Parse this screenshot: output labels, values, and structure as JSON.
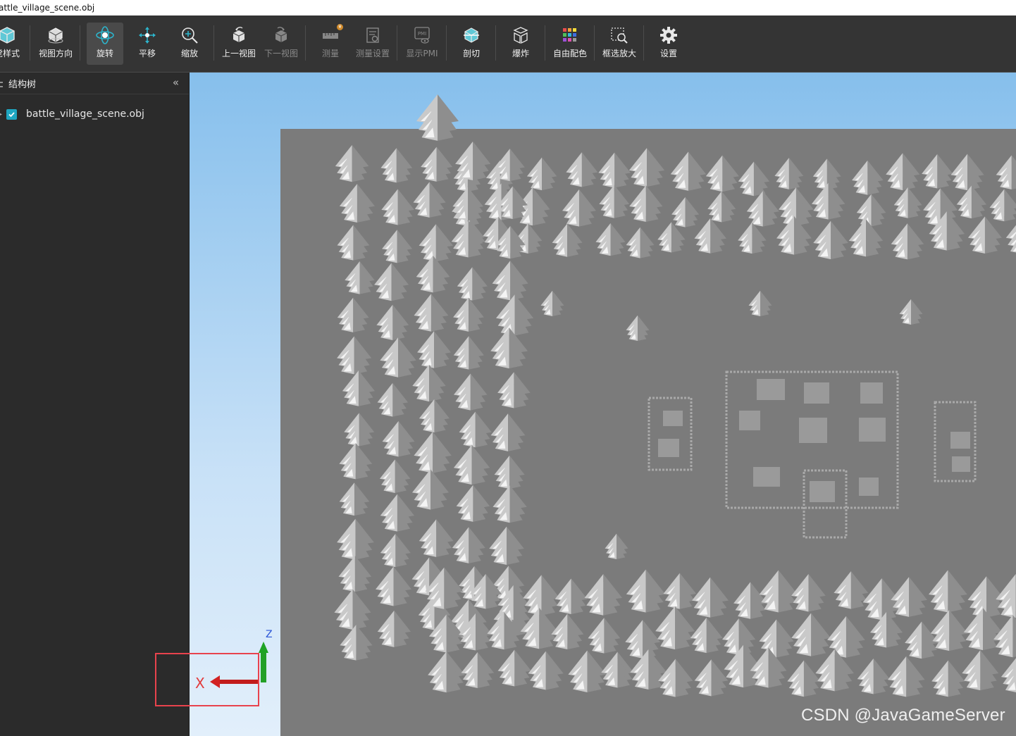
{
  "window": {
    "title": "attle_village_scene.obj"
  },
  "toolbar": {
    "items": [
      {
        "label": "觉样式",
        "icon": "display-style-icon",
        "state": "normal"
      },
      {
        "label": "视图方向",
        "icon": "view-direction-icon",
        "state": "normal"
      },
      {
        "label": "旋转",
        "icon": "rotate-icon",
        "state": "active"
      },
      {
        "label": "平移",
        "icon": "pan-icon",
        "state": "normal"
      },
      {
        "label": "缩放",
        "icon": "zoom-icon",
        "state": "normal"
      },
      {
        "label": "上一视图",
        "icon": "previous-view-icon",
        "state": "normal"
      },
      {
        "label": "下一视图",
        "icon": "next-view-icon",
        "state": "disabled"
      },
      {
        "label": "测量",
        "icon": "measure-icon",
        "state": "disabled"
      },
      {
        "label": "测量设置",
        "icon": "measure-settings-icon",
        "state": "disabled"
      },
      {
        "label": "显示PMI",
        "icon": "show-pmi-icon",
        "state": "disabled"
      },
      {
        "label": "剖切",
        "icon": "section-icon",
        "state": "normal"
      },
      {
        "label": "爆炸",
        "icon": "explode-icon",
        "state": "normal"
      },
      {
        "label": "自由配色",
        "icon": "free-color-icon",
        "state": "normal"
      },
      {
        "label": "框选放大",
        "icon": "box-zoom-icon",
        "state": "normal"
      },
      {
        "label": "设置",
        "icon": "settings-gear-icon",
        "state": "normal"
      }
    ],
    "measure_badge": "¥"
  },
  "sidebar": {
    "title": "结构树",
    "collapse_icon": "«",
    "tree": [
      {
        "label": "battle_village_scene.obj",
        "checked": true
      }
    ]
  },
  "viewport": {
    "axis_x_label": "X",
    "axis_z_label": "Z",
    "watermark": "CSDN @JavaGameServer"
  },
  "colors": {
    "toolbar_bg": "#343434",
    "sidebar_bg": "#2b2b2b",
    "accent": "#1fa7c2",
    "ground": "#7b7b7b",
    "highlight_box": "#e8434d"
  }
}
